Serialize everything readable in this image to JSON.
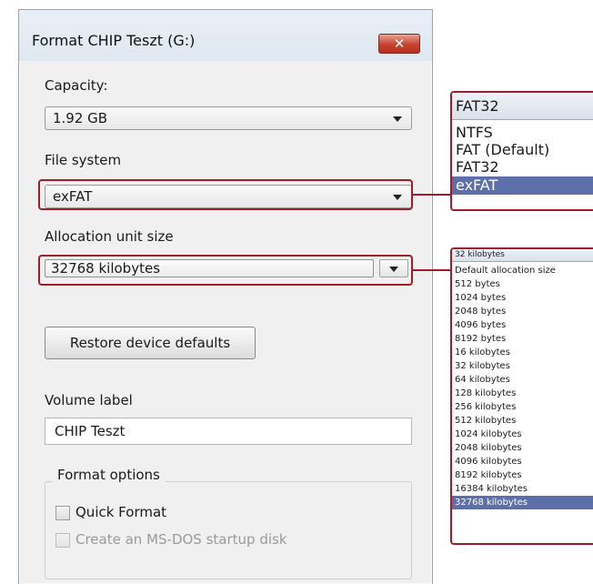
{
  "dialog": {
    "title": "Format CHIP Teszt (G:)",
    "close_label": "✕",
    "capacity_label": "Capacity:",
    "capacity_value": "1.92 GB",
    "filesystem_label": "File system",
    "filesystem_value": "exFAT",
    "allocation_label": "Allocation unit size",
    "allocation_value": "32768 kilobytes",
    "restore_button": "Restore device defaults",
    "volume_label": "Volume label",
    "volume_value": "CHIP Teszt",
    "format_options_label": "Format options",
    "quick_format_label": "Quick Format",
    "msdos_label": "Create an MS-DOS startup disk"
  },
  "fs_dropdown": {
    "current": "FAT32",
    "options": [
      "NTFS",
      "FAT (Default)",
      "FAT32",
      "exFAT"
    ],
    "selected_index": 3
  },
  "alloc_dropdown": {
    "current": "32 kilobytes",
    "options": [
      "Default allocation size",
      "512 bytes",
      "1024 bytes",
      "2048 bytes",
      "4096 bytes",
      "8192 bytes",
      "16 kilobytes",
      "32 kilobytes",
      "64 kilobytes",
      "128 kilobytes",
      "256 kilobytes",
      "512 kilobytes",
      "1024 kilobytes",
      "2048 kilobytes",
      "4096 kilobytes",
      "8192 kilobytes",
      "16384 kilobytes",
      "32768 kilobytes"
    ],
    "selected_index": 17
  },
  "colors": {
    "highlight": "#a31b2a",
    "selection": "#5c6fa8",
    "close_button": "#c6412e"
  }
}
